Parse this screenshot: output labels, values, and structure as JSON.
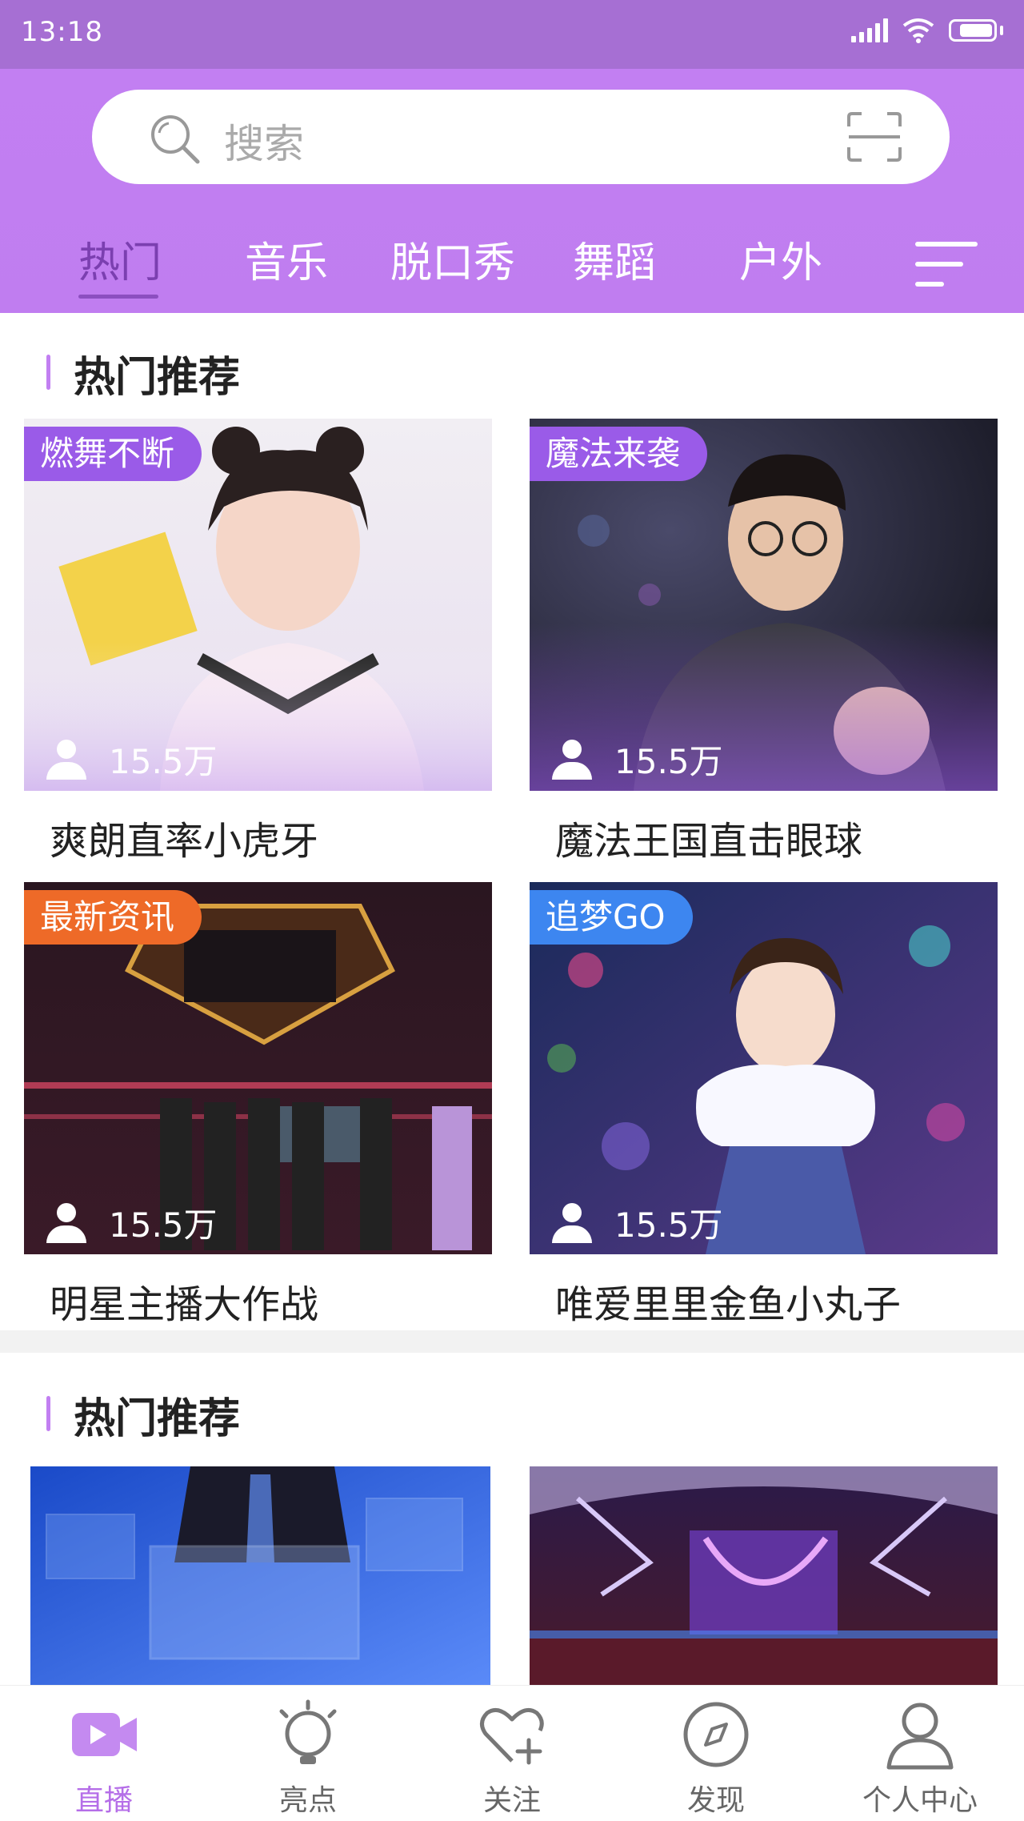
{
  "status_bar": {
    "time": "13:18"
  },
  "search": {
    "placeholder": "搜索"
  },
  "tabs": [
    {
      "label": "热门",
      "active": true
    },
    {
      "label": "音乐",
      "active": false
    },
    {
      "label": "脱口秀",
      "active": false
    },
    {
      "label": "舞蹈",
      "active": false
    },
    {
      "label": "户外",
      "active": false
    }
  ],
  "sections": [
    {
      "title": "热门推荐",
      "cards": [
        {
          "tag": "燃舞不断",
          "tag_color": "#9a5be8",
          "viewers": "15.5万",
          "title": "爽朗直率小虎牙"
        },
        {
          "tag": "魔法来袭",
          "tag_color": "#9a5be8",
          "viewers": "15.5万",
          "title": "魔法王国直击眼球"
        },
        {
          "tag": "最新资讯",
          "tag_color": "#ee6a28",
          "viewers": "15.5万",
          "title": "明星主播大作战"
        },
        {
          "tag": "追梦GO",
          "tag_color": "#3d86f0",
          "viewers": "15.5万",
          "title": "唯爱里里金鱼小丸子"
        }
      ]
    },
    {
      "title": "热门推荐"
    }
  ],
  "bottom_nav": [
    {
      "label": "直播",
      "icon": "live-video-icon",
      "active": true
    },
    {
      "label": "亮点",
      "icon": "lightbulb-icon",
      "active": false
    },
    {
      "label": "关注",
      "icon": "heart-plus-icon",
      "active": false
    },
    {
      "label": "发现",
      "icon": "compass-icon",
      "active": false
    },
    {
      "label": "个人中心",
      "icon": "person-icon",
      "active": false
    }
  ],
  "colors": {
    "accent": "#c27ff2",
    "status_bar": "#a66fd3",
    "active_tab": "#7b3fb0"
  }
}
